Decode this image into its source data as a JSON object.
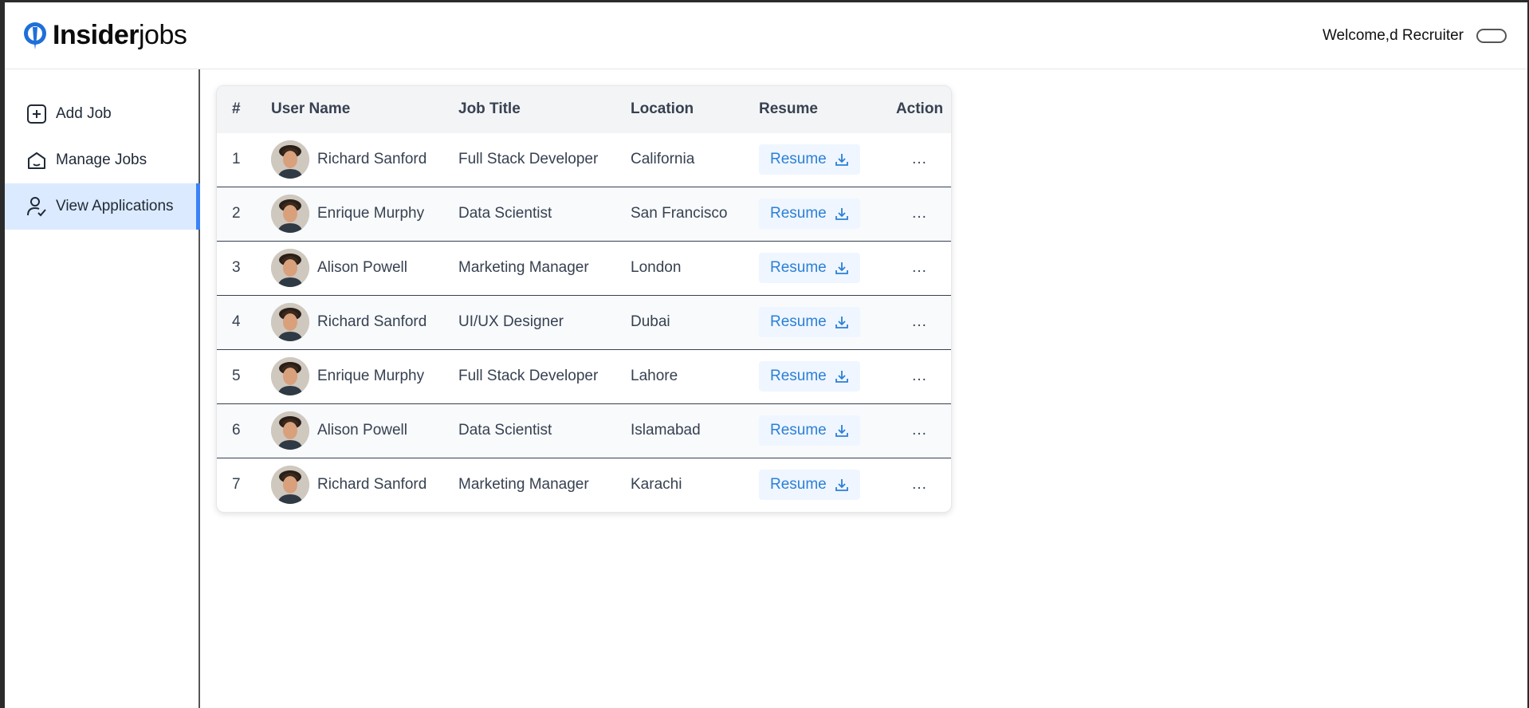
{
  "header": {
    "brand_bold": "Insider",
    "brand_light": "jobs",
    "welcome": "Welcome,d Recruiter"
  },
  "sidebar": {
    "items": [
      {
        "label": "Add Job",
        "icon": "add-square-icon"
      },
      {
        "label": "Manage Jobs",
        "icon": "home-icon"
      },
      {
        "label": "View Applications",
        "icon": "person-check-icon",
        "active": true
      }
    ]
  },
  "table": {
    "headers": [
      "#",
      "User Name",
      "Job Title",
      "Location",
      "Resume",
      "Action"
    ],
    "rows": [
      {
        "num": "1",
        "name": "Richard Sanford",
        "job": "Full Stack Developer",
        "location": "California",
        "resume": "Resume",
        "action": "..."
      },
      {
        "num": "2",
        "name": "Enrique Murphy",
        "job": "Data Scientist",
        "location": "San Francisco",
        "resume": "Resume",
        "action": "..."
      },
      {
        "num": "3",
        "name": "Alison Powell",
        "job": "Marketing Manager",
        "location": "London",
        "resume": "Resume",
        "action": "..."
      },
      {
        "num": "4",
        "name": "Richard Sanford",
        "job": "UI/UX Designer",
        "location": "Dubai",
        "resume": "Resume",
        "action": "..."
      },
      {
        "num": "5",
        "name": "Enrique Murphy",
        "job": "Full Stack Developer",
        "location": "Lahore",
        "resume": "Resume",
        "action": "..."
      },
      {
        "num": "6",
        "name": "Alison Powell",
        "job": "Data Scientist",
        "location": "Islamabad",
        "resume": "Resume",
        "action": "..."
      },
      {
        "num": "7",
        "name": "Richard Sanford",
        "job": "Marketing Manager",
        "location": "Karachi",
        "resume": "Resume",
        "action": "..."
      }
    ]
  },
  "colors": {
    "accent": "#3b82f6",
    "active_bg": "#dbeafe",
    "resume_text": "#2b7fd6",
    "resume_bg": "#eff6ff"
  }
}
